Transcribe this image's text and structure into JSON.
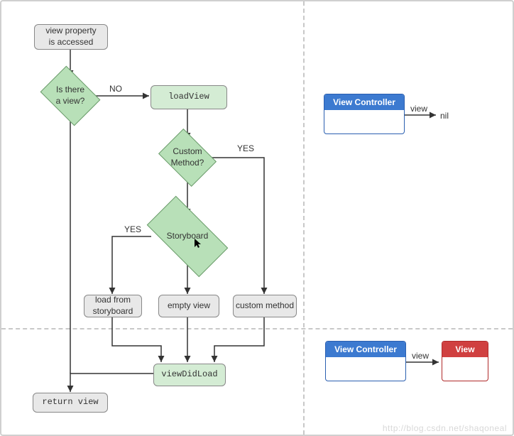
{
  "flow": {
    "start": "view property\nis accessed",
    "d_isview": "Is there\na view?",
    "d_isview_no": "NO",
    "loadview": "loadView",
    "d_custom": "Custom\nMethod?",
    "d_custom_yes": "YES",
    "d_storyboard": "Storyboard",
    "d_storyboard_yes": "YES",
    "box_loadsb": "load from\nstoryboard",
    "box_empty": "empty view",
    "box_custommethod": "custom method",
    "viewdidload": "viewDidLoad",
    "returnview": "return view"
  },
  "right": {
    "vc_label1": "View Controller",
    "vc_label2": "View Controller",
    "view_edge1": "view",
    "nil": "nil",
    "view_edge2": "view",
    "view_label": "View"
  },
  "watermark": "http://blog.csdn.net/shaqoneal"
}
